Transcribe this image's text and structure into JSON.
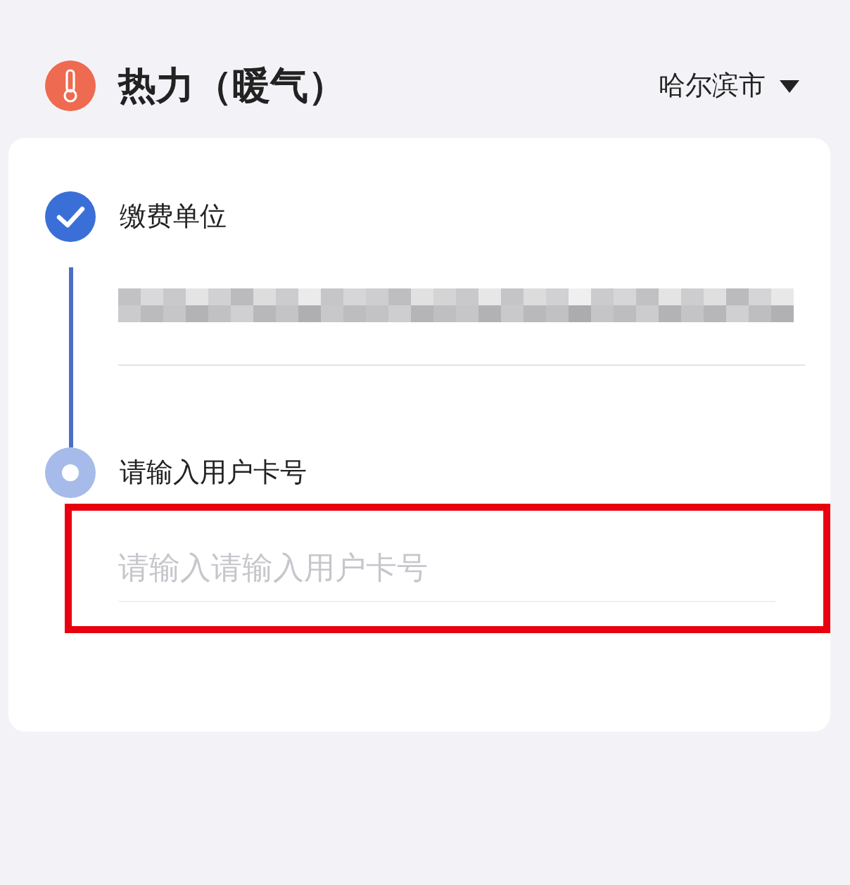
{
  "header": {
    "title": "热力（暖气）",
    "city": "哈尔滨市"
  },
  "steps": [
    {
      "label": "缴费单位",
      "done": true,
      "field": {
        "kind": "redacted"
      }
    },
    {
      "label": "请输入用户卡号",
      "done": false,
      "field": {
        "kind": "input",
        "placeholder": "请输入请输入用户卡号",
        "highlighted": true
      }
    }
  ]
}
